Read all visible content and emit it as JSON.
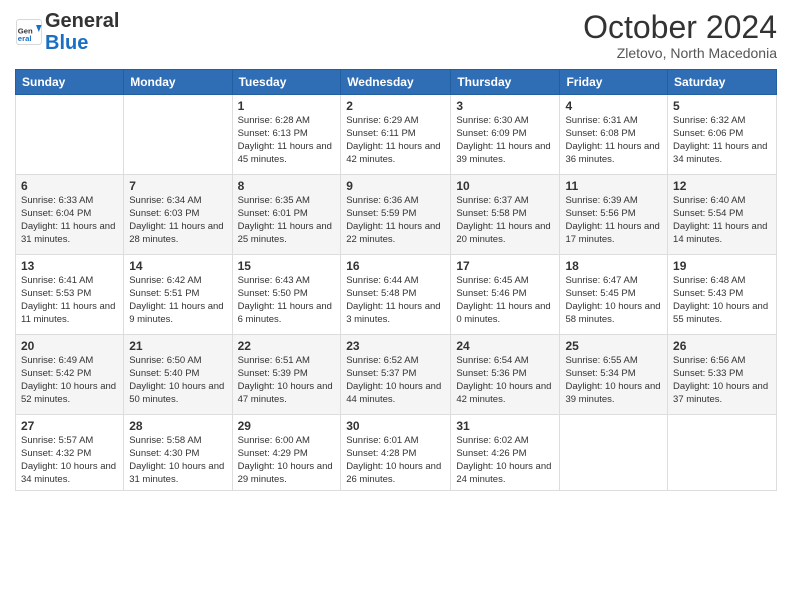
{
  "header": {
    "logo_general": "General",
    "logo_blue": "Blue",
    "month": "October 2024",
    "location": "Zletovo, North Macedonia"
  },
  "weekdays": [
    "Sunday",
    "Monday",
    "Tuesday",
    "Wednesday",
    "Thursday",
    "Friday",
    "Saturday"
  ],
  "weeks": [
    [
      {
        "day": "",
        "sunrise": "",
        "sunset": "",
        "daylight": ""
      },
      {
        "day": "",
        "sunrise": "",
        "sunset": "",
        "daylight": ""
      },
      {
        "day": "1",
        "sunrise": "Sunrise: 6:28 AM",
        "sunset": "Sunset: 6:13 PM",
        "daylight": "Daylight: 11 hours and 45 minutes."
      },
      {
        "day": "2",
        "sunrise": "Sunrise: 6:29 AM",
        "sunset": "Sunset: 6:11 PM",
        "daylight": "Daylight: 11 hours and 42 minutes."
      },
      {
        "day": "3",
        "sunrise": "Sunrise: 6:30 AM",
        "sunset": "Sunset: 6:09 PM",
        "daylight": "Daylight: 11 hours and 39 minutes."
      },
      {
        "day": "4",
        "sunrise": "Sunrise: 6:31 AM",
        "sunset": "Sunset: 6:08 PM",
        "daylight": "Daylight: 11 hours and 36 minutes."
      },
      {
        "day": "5",
        "sunrise": "Sunrise: 6:32 AM",
        "sunset": "Sunset: 6:06 PM",
        "daylight": "Daylight: 11 hours and 34 minutes."
      }
    ],
    [
      {
        "day": "6",
        "sunrise": "Sunrise: 6:33 AM",
        "sunset": "Sunset: 6:04 PM",
        "daylight": "Daylight: 11 hours and 31 minutes."
      },
      {
        "day": "7",
        "sunrise": "Sunrise: 6:34 AM",
        "sunset": "Sunset: 6:03 PM",
        "daylight": "Daylight: 11 hours and 28 minutes."
      },
      {
        "day": "8",
        "sunrise": "Sunrise: 6:35 AM",
        "sunset": "Sunset: 6:01 PM",
        "daylight": "Daylight: 11 hours and 25 minutes."
      },
      {
        "day": "9",
        "sunrise": "Sunrise: 6:36 AM",
        "sunset": "Sunset: 5:59 PM",
        "daylight": "Daylight: 11 hours and 22 minutes."
      },
      {
        "day": "10",
        "sunrise": "Sunrise: 6:37 AM",
        "sunset": "Sunset: 5:58 PM",
        "daylight": "Daylight: 11 hours and 20 minutes."
      },
      {
        "day": "11",
        "sunrise": "Sunrise: 6:39 AM",
        "sunset": "Sunset: 5:56 PM",
        "daylight": "Daylight: 11 hours and 17 minutes."
      },
      {
        "day": "12",
        "sunrise": "Sunrise: 6:40 AM",
        "sunset": "Sunset: 5:54 PM",
        "daylight": "Daylight: 11 hours and 14 minutes."
      }
    ],
    [
      {
        "day": "13",
        "sunrise": "Sunrise: 6:41 AM",
        "sunset": "Sunset: 5:53 PM",
        "daylight": "Daylight: 11 hours and 11 minutes."
      },
      {
        "day": "14",
        "sunrise": "Sunrise: 6:42 AM",
        "sunset": "Sunset: 5:51 PM",
        "daylight": "Daylight: 11 hours and 9 minutes."
      },
      {
        "day": "15",
        "sunrise": "Sunrise: 6:43 AM",
        "sunset": "Sunset: 5:50 PM",
        "daylight": "Daylight: 11 hours and 6 minutes."
      },
      {
        "day": "16",
        "sunrise": "Sunrise: 6:44 AM",
        "sunset": "Sunset: 5:48 PM",
        "daylight": "Daylight: 11 hours and 3 minutes."
      },
      {
        "day": "17",
        "sunrise": "Sunrise: 6:45 AM",
        "sunset": "Sunset: 5:46 PM",
        "daylight": "Daylight: 11 hours and 0 minutes."
      },
      {
        "day": "18",
        "sunrise": "Sunrise: 6:47 AM",
        "sunset": "Sunset: 5:45 PM",
        "daylight": "Daylight: 10 hours and 58 minutes."
      },
      {
        "day": "19",
        "sunrise": "Sunrise: 6:48 AM",
        "sunset": "Sunset: 5:43 PM",
        "daylight": "Daylight: 10 hours and 55 minutes."
      }
    ],
    [
      {
        "day": "20",
        "sunrise": "Sunrise: 6:49 AM",
        "sunset": "Sunset: 5:42 PM",
        "daylight": "Daylight: 10 hours and 52 minutes."
      },
      {
        "day": "21",
        "sunrise": "Sunrise: 6:50 AM",
        "sunset": "Sunset: 5:40 PM",
        "daylight": "Daylight: 10 hours and 50 minutes."
      },
      {
        "day": "22",
        "sunrise": "Sunrise: 6:51 AM",
        "sunset": "Sunset: 5:39 PM",
        "daylight": "Daylight: 10 hours and 47 minutes."
      },
      {
        "day": "23",
        "sunrise": "Sunrise: 6:52 AM",
        "sunset": "Sunset: 5:37 PM",
        "daylight": "Daylight: 10 hours and 44 minutes."
      },
      {
        "day": "24",
        "sunrise": "Sunrise: 6:54 AM",
        "sunset": "Sunset: 5:36 PM",
        "daylight": "Daylight: 10 hours and 42 minutes."
      },
      {
        "day": "25",
        "sunrise": "Sunrise: 6:55 AM",
        "sunset": "Sunset: 5:34 PM",
        "daylight": "Daylight: 10 hours and 39 minutes."
      },
      {
        "day": "26",
        "sunrise": "Sunrise: 6:56 AM",
        "sunset": "Sunset: 5:33 PM",
        "daylight": "Daylight: 10 hours and 37 minutes."
      }
    ],
    [
      {
        "day": "27",
        "sunrise": "Sunrise: 5:57 AM",
        "sunset": "Sunset: 4:32 PM",
        "daylight": "Daylight: 10 hours and 34 minutes."
      },
      {
        "day": "28",
        "sunrise": "Sunrise: 5:58 AM",
        "sunset": "Sunset: 4:30 PM",
        "daylight": "Daylight: 10 hours and 31 minutes."
      },
      {
        "day": "29",
        "sunrise": "Sunrise: 6:00 AM",
        "sunset": "Sunset: 4:29 PM",
        "daylight": "Daylight: 10 hours and 29 minutes."
      },
      {
        "day": "30",
        "sunrise": "Sunrise: 6:01 AM",
        "sunset": "Sunset: 4:28 PM",
        "daylight": "Daylight: 10 hours and 26 minutes."
      },
      {
        "day": "31",
        "sunrise": "Sunrise: 6:02 AM",
        "sunset": "Sunset: 4:26 PM",
        "daylight": "Daylight: 10 hours and 24 minutes."
      },
      {
        "day": "",
        "sunrise": "",
        "sunset": "",
        "daylight": ""
      },
      {
        "day": "",
        "sunrise": "",
        "sunset": "",
        "daylight": ""
      }
    ]
  ]
}
